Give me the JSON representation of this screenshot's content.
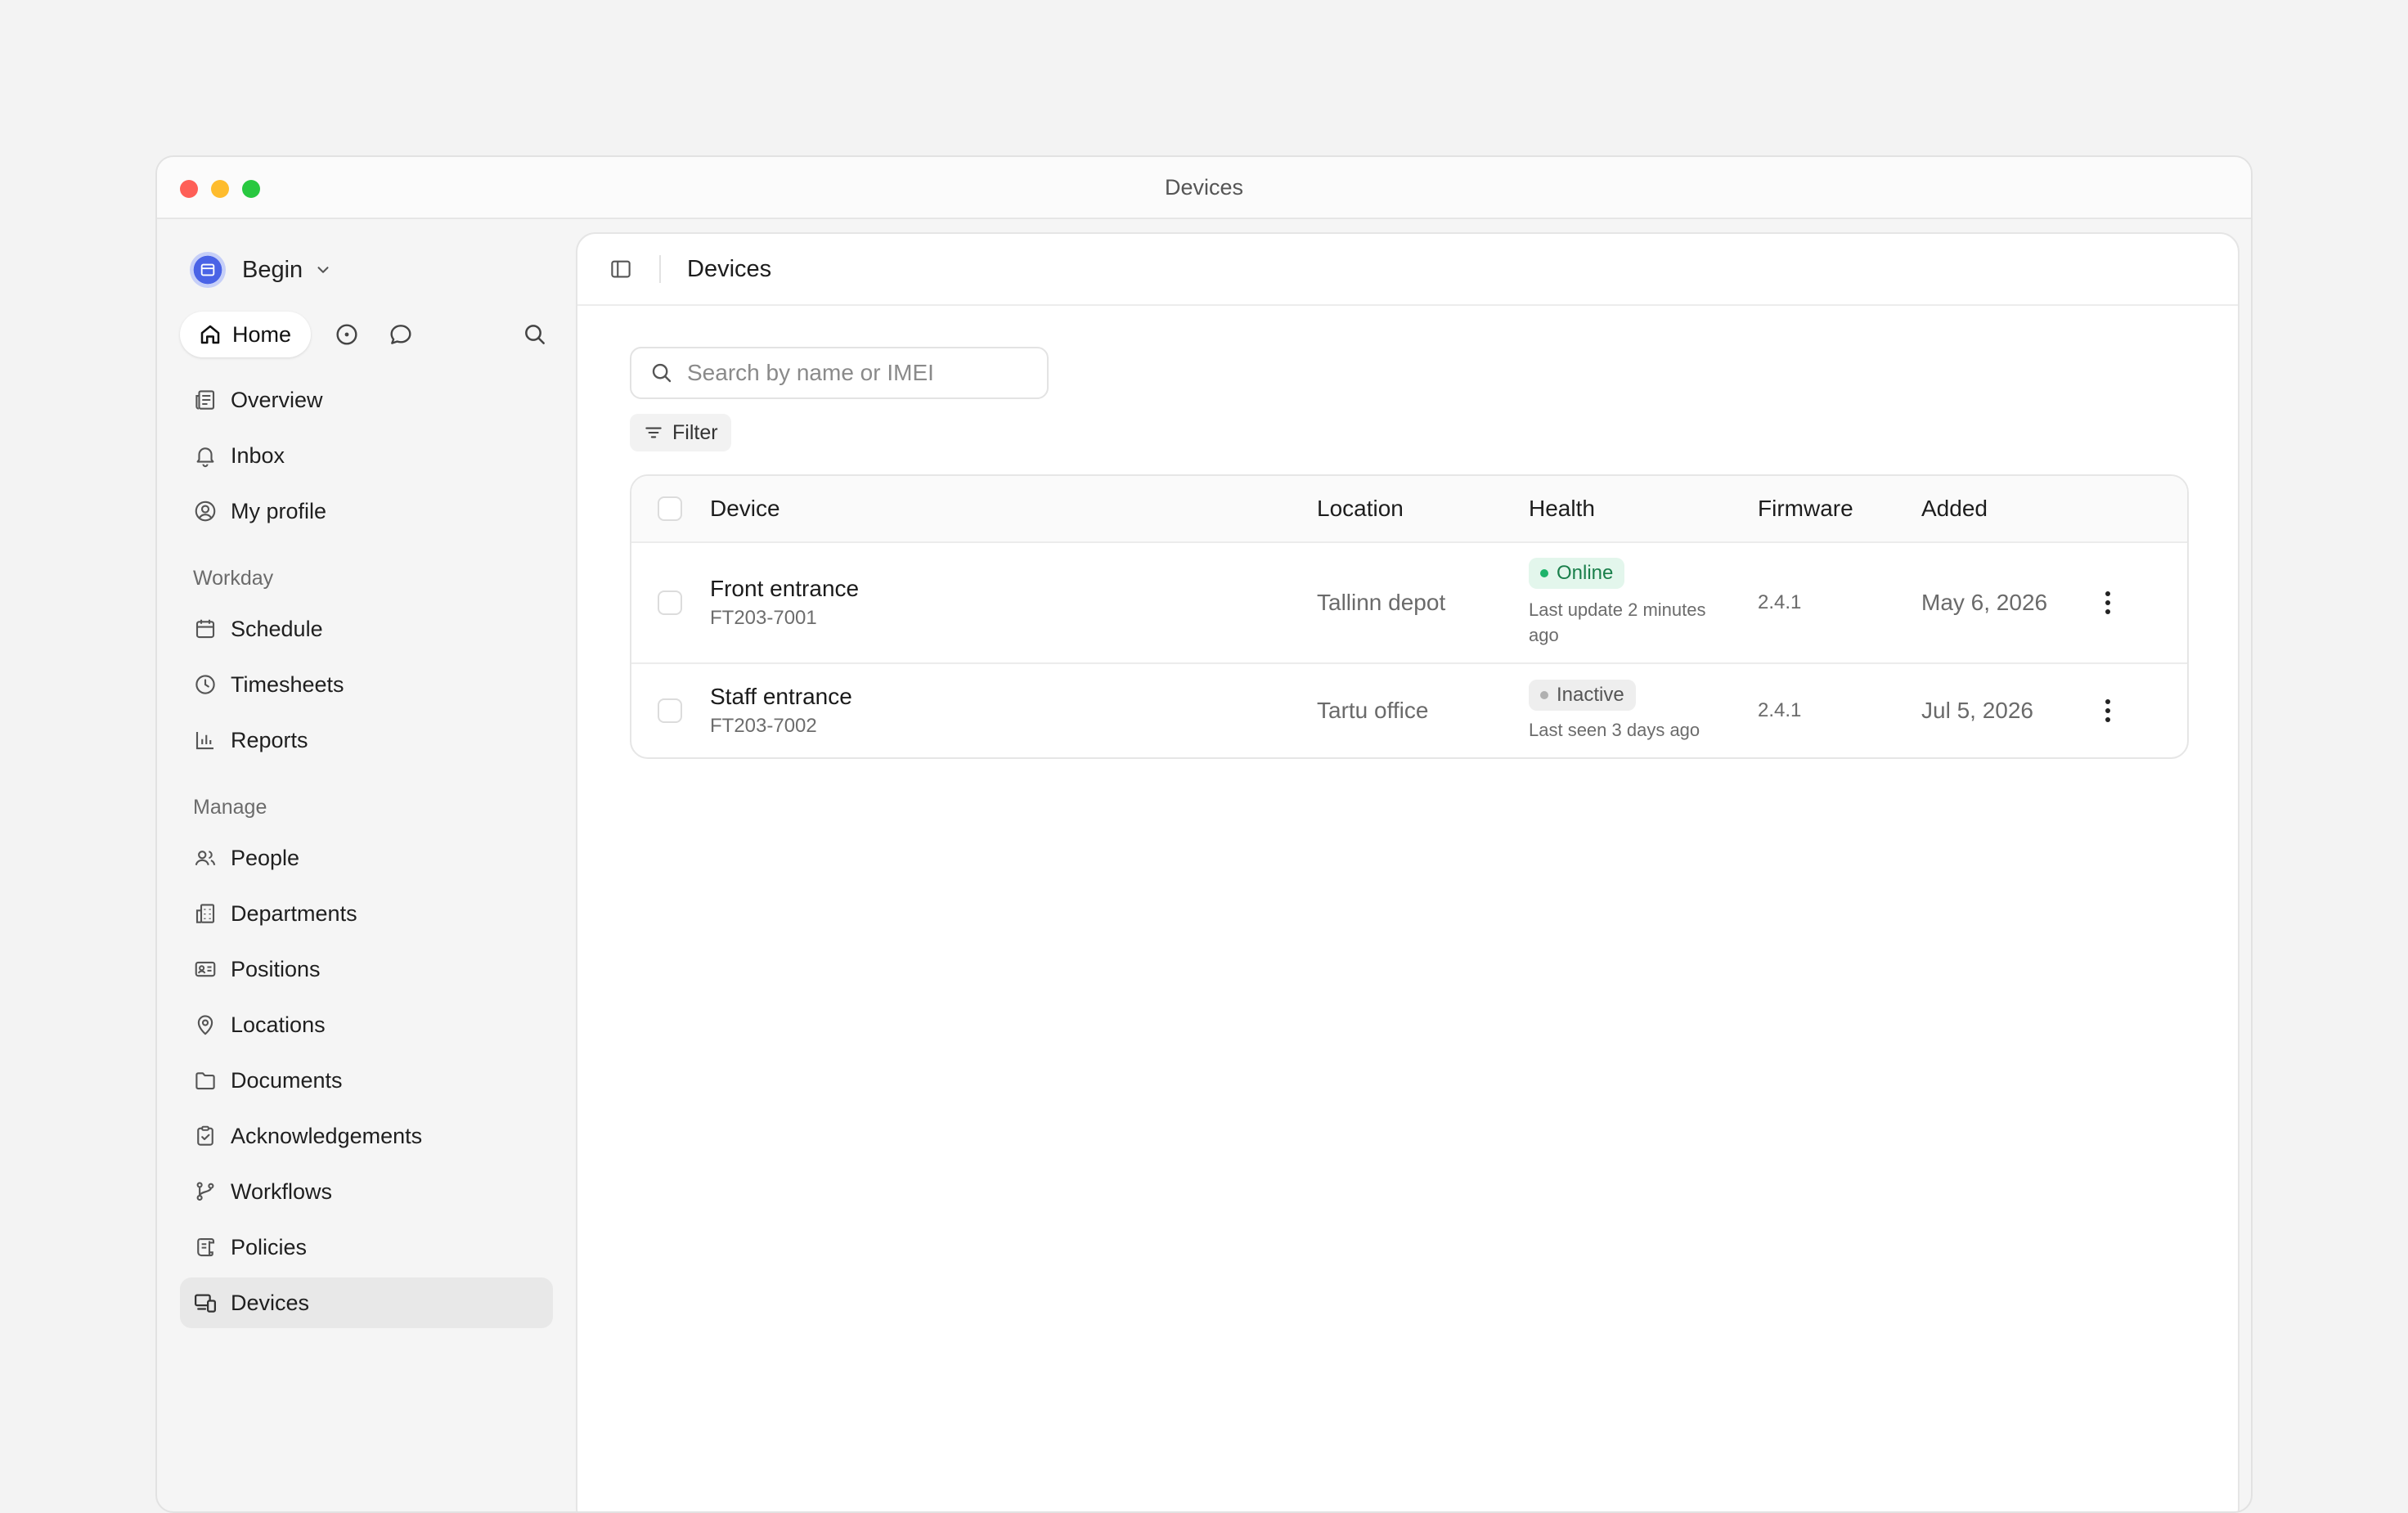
{
  "window": {
    "title": "Devices"
  },
  "sidebar": {
    "workspace": {
      "name": "Begin"
    },
    "quick": {
      "home_label": "Home"
    },
    "items_top": [
      {
        "label": "Overview",
        "icon": "newspaper-icon"
      },
      {
        "label": "Inbox",
        "icon": "bell-icon"
      },
      {
        "label": "My profile",
        "icon": "user-circle-icon"
      }
    ],
    "sections": [
      {
        "title": "Workday",
        "items": [
          {
            "label": "Schedule",
            "icon": "calendar-icon"
          },
          {
            "label": "Timesheets",
            "icon": "clock-icon"
          },
          {
            "label": "Reports",
            "icon": "bar-chart-icon"
          }
        ]
      },
      {
        "title": "Manage",
        "items": [
          {
            "label": "People",
            "icon": "users-icon"
          },
          {
            "label": "Departments",
            "icon": "building-icon"
          },
          {
            "label": "Positions",
            "icon": "id-card-icon"
          },
          {
            "label": "Locations",
            "icon": "map-pin-icon"
          },
          {
            "label": "Documents",
            "icon": "folder-icon"
          },
          {
            "label": "Acknowledgements",
            "icon": "clipboard-check-icon"
          },
          {
            "label": "Workflows",
            "icon": "git-branch-icon"
          },
          {
            "label": "Policies",
            "icon": "scroll-icon"
          },
          {
            "label": "Devices",
            "icon": "devices-icon",
            "active": true
          }
        ]
      }
    ]
  },
  "main": {
    "title": "Devices",
    "search": {
      "placeholder": "Search by name or IMEI",
      "value": ""
    },
    "filter_label": "Filter",
    "table": {
      "columns": [
        "Device",
        "Location",
        "Health",
        "Firmware",
        "Added"
      ],
      "rows": [
        {
          "name": "Front entrance",
          "id": "FT203-7001",
          "location": "Tallinn depot",
          "health": {
            "status": "Online",
            "detail": "Last update 2 minutes ago"
          },
          "firmware": "2.4.1",
          "added": "May 6, 2026"
        },
        {
          "name": "Staff entrance",
          "id": "FT203-7002",
          "location": "Tartu office",
          "health": {
            "status": "Inactive",
            "detail": "Last seen 3 days ago"
          },
          "firmware": "2.4.1",
          "added": "Jul 5, 2026"
        }
      ]
    }
  },
  "colors": {
    "online": "#1db36a",
    "inactive": "#b0b0b0",
    "accent": "#4a63e6"
  }
}
